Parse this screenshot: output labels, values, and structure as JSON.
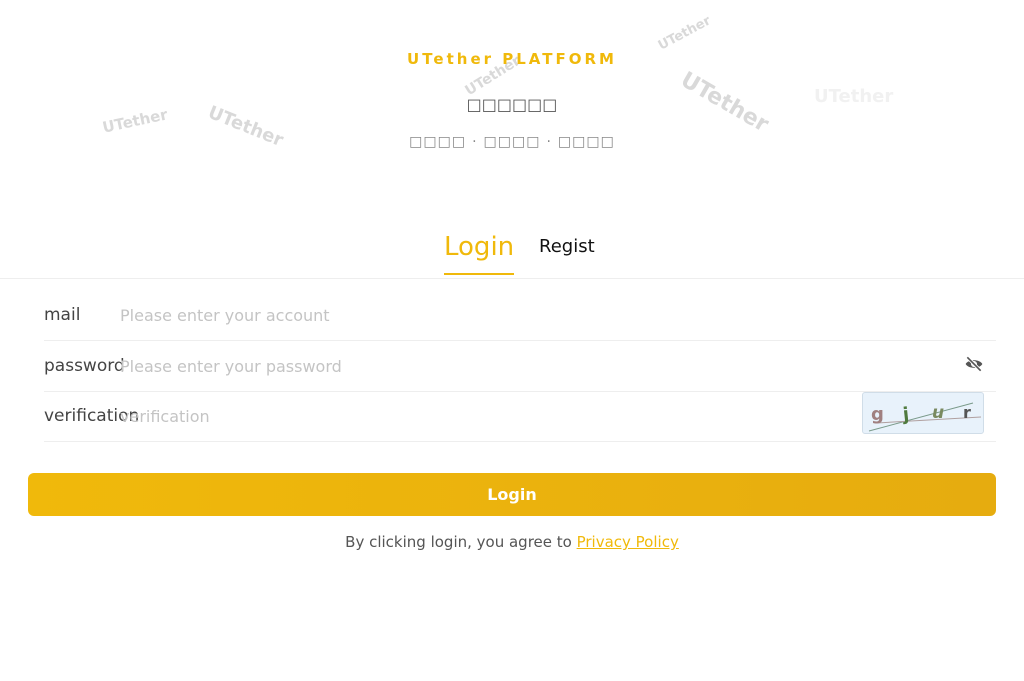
{
  "brand": {
    "title": "UTether PLATFORM",
    "subtitle": "□□□□□□",
    "tagline": [
      "□□□□",
      "□□□□",
      "□□□□"
    ],
    "accent_color": "#f0b90b",
    "watermark_text": "UTether"
  },
  "tabs": [
    {
      "label": "Login",
      "active": true
    },
    {
      "label": "Regist",
      "active": false
    }
  ],
  "form": {
    "mail": {
      "label": "mail",
      "placeholder": "Please enter your account",
      "value": ""
    },
    "password": {
      "label": "password",
      "placeholder": "Please enter your password",
      "value": "",
      "toggle_icon": "eye-off-icon"
    },
    "verification": {
      "label": "verification",
      "placeholder": "verification",
      "value": "",
      "captcha_chars": [
        "g",
        "j",
        "u",
        "r"
      ]
    }
  },
  "login_button": "Login",
  "agreement": {
    "text": "By clicking login, you agree to",
    "link": "Privacy Policy"
  }
}
